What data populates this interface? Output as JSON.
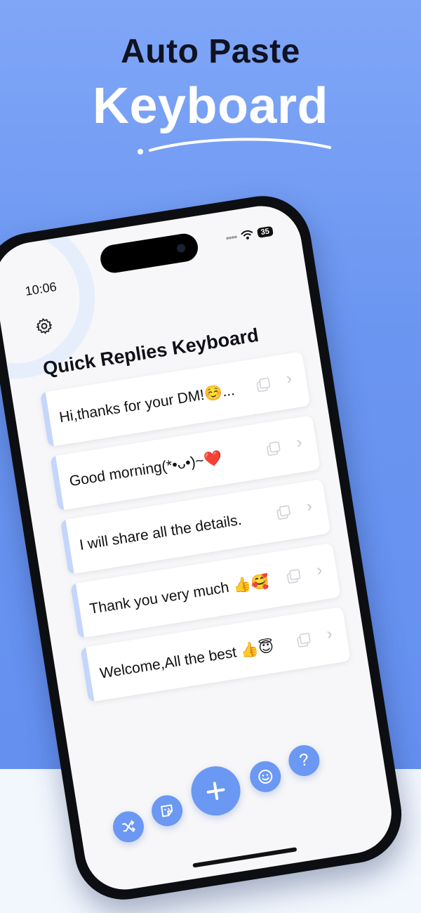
{
  "promo": {
    "headline_line1": "Auto Paste",
    "headline_line2": "Keyboard"
  },
  "status_bar": {
    "time": "10:06",
    "battery": "35"
  },
  "app": {
    "title": "Quick Replies Keyboard"
  },
  "replies": [
    {
      "text": "Hi,thanks for your DM!☺️..."
    },
    {
      "text": "Good morning(*•ᴗ•)~❤️"
    },
    {
      "text": "I will share all the details."
    },
    {
      "text": "Thank you very much 👍🥰"
    },
    {
      "text": "Welcome,All the best 👍😇"
    }
  ],
  "toolbar": {
    "help_label": "?"
  },
  "colors": {
    "accent": "#6b98f2",
    "card_accent": "#c4d6fb",
    "background_blue": "#6a95f0",
    "headline_dark": "#0f1222"
  },
  "icons": [
    "gear-icon",
    "copy-icon",
    "chevron-right-icon",
    "shuffle-icon",
    "sticker-icon",
    "plus-icon",
    "smiley-icon",
    "question-icon",
    "wifi-icon"
  ]
}
